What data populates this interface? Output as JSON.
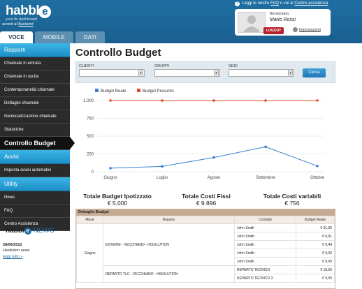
{
  "header": {
    "logo_text": "habbl",
    "logo_letter": "e",
    "tagline": "your tlc dashboard",
    "access_prefix": "accedi al",
    "access_link": "Backend",
    "help_prefix": "Leggi le nostre",
    "help_faq": "FAQ",
    "help_middle": "o vai al",
    "help_center": "Centro assistenza",
    "tabs": [
      {
        "label": "VOCE",
        "active": true
      },
      {
        "label": "MOBILE",
        "active": false
      },
      {
        "label": "DATI",
        "active": false
      }
    ]
  },
  "user": {
    "welcome": "Bentornato,",
    "name": "Mario Rossi",
    "logout_label": "LOGOUT",
    "settings_label": "Impostazioni"
  },
  "sidebar": {
    "sections": [
      {
        "label": "Rapporti",
        "items": [
          {
            "label": "Chiamate in entrata",
            "active": false
          },
          {
            "label": "Chiamate in uscita",
            "active": false
          },
          {
            "label": "Contemporaneità chiamate",
            "active": false
          },
          {
            "label": "Dettaglio chiamate",
            "active": false
          },
          {
            "label": "Geolocalizzazione chiamate",
            "active": false
          },
          {
            "label": "Statistiche",
            "active": false
          },
          {
            "label": "Controllo Budget",
            "active": true
          }
        ]
      },
      {
        "label": "Avvisi",
        "items": [
          {
            "label": "Imposta avvisi automatici",
            "active": false
          }
        ]
      },
      {
        "label": "Utility",
        "items": [
          {
            "label": "News",
            "active": false
          },
          {
            "label": "FAQ",
            "active": false
          },
          {
            "label": "Centro Assistenza",
            "active": false
          }
        ]
      }
    ],
    "news": {
      "logo": "habbl",
      "logo_letter": "e",
      "logo_word": "NEWS",
      "date": "28/06/2012",
      "text": "Hisolution news",
      "more": "leggi tutto »"
    }
  },
  "main": {
    "title": "Controllo Budget",
    "filters": {
      "clienti_label": "CLIENTI",
      "gruppi_label": "GRUPPI",
      "sedi_label": "SEDI",
      "search_label": "Cerca"
    },
    "totals": [
      {
        "label": "Totale Budget Ipotizzato",
        "value": "€ 5.000"
      },
      {
        "label": "Totale Costi Fissi",
        "value": "€ 9.896"
      },
      {
        "label": "Totale Costi variabili",
        "value": "€ 756"
      }
    ],
    "table": {
      "title": "Dettaglio Budget",
      "columns": [
        "Mese",
        "Reparto",
        "Contatto",
        "Budget Reale"
      ],
      "month": "Giugno",
      "groups": [
        {
          "reparto": "ESTERNI - VECCHIANO - HISOLUTION",
          "rows": [
            {
              "contatto": "John Smith",
              "budget": "€ 31,05"
            },
            {
              "contatto": "John Smith",
              "budget": "€ 0,91"
            },
            {
              "contatto": "John Smith",
              "budget": "€ 0,44"
            },
            {
              "contatto": "John Smith",
              "budget": "€ 0,00"
            },
            {
              "contatto": "John Smith",
              "budget": "€ 0,00"
            }
          ]
        },
        {
          "reparto": "REPARTO TLC - VECCHIANO - HISOLUTION",
          "rows": [
            {
              "contatto": "REPARTO TECNICO",
              "budget": "€ 18,66"
            },
            {
              "contatto": "REPARTO TECNICO 3",
              "budget": "€ 0,00"
            }
          ]
        }
      ]
    }
  },
  "colors": {
    "header_blue": "#1a5f8f",
    "series_reale": "#3a7fd4",
    "series_presunto": "#e04a2a",
    "sidebar_dark": "#2b2b2b",
    "section_blue": "#1c8fc6"
  },
  "chart_data": {
    "type": "line",
    "categories": [
      "Giugno",
      "Luglio",
      "Agosto",
      "Settembre",
      "Ottobre"
    ],
    "series": [
      {
        "name": "Budget Reale",
        "values": [
          50,
          75,
          200,
          350,
          80
        ]
      },
      {
        "name": "Budget Presunto",
        "values": [
          1000,
          1000,
          1000,
          1000,
          1000
        ]
      }
    ],
    "ylim": [
      0,
      1000
    ],
    "yticks": [
      "0",
      "250",
      "500",
      "750",
      "1.000"
    ],
    "grid": true,
    "legend": "top-left"
  }
}
